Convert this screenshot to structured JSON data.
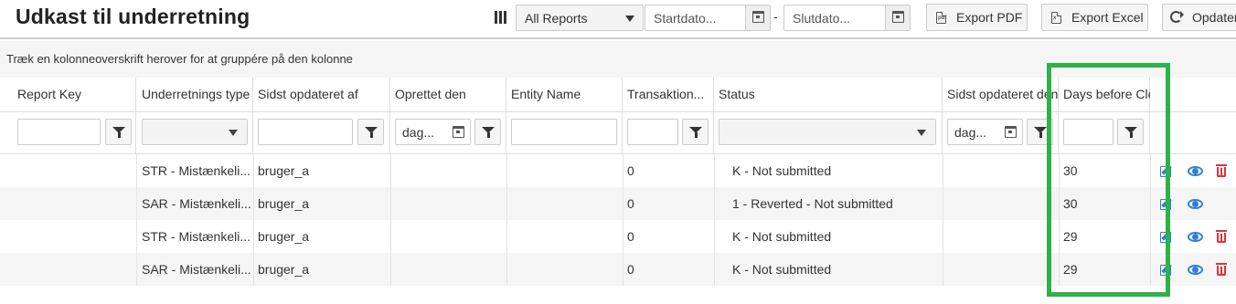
{
  "title": "Udkast til underretning",
  "toolbar": {
    "report_filter": "All Reports",
    "start_date_placeholder": "Startdato...",
    "end_date_placeholder": "Slutdato...",
    "date_separator": "-",
    "export_pdf": "Export PDF",
    "export_excel": "Export Excel",
    "refresh": "Opdater"
  },
  "group_panel": "Træk en kolonneoverskrift herover for at gruppére på den kolonne",
  "columns": [
    "Report Key",
    "Underretnings type",
    "Sidst opdateret af",
    "Oprettet den",
    "Entity Name",
    "Transaktion...",
    "Status",
    "Sidst opdateret den",
    "Days before Cle"
  ],
  "filters": {
    "created_date_placeholder": "dag...",
    "updated_date_placeholder": "dag..."
  },
  "rows": [
    {
      "report_key": "",
      "type": "STR - Mistænkeli...",
      "updated_by": "bruger_a",
      "created": "",
      "entity": "",
      "transactions": "0",
      "status": "K - Not submitted",
      "updated": "",
      "days": "30",
      "can_delete": true
    },
    {
      "report_key": "",
      "type": "SAR - Mistænkeli...",
      "updated_by": "bruger_a",
      "created": "",
      "entity": "",
      "transactions": "0",
      "status": "1 - Reverted - Not submitted",
      "updated": "",
      "days": "30",
      "can_delete": false
    },
    {
      "report_key": "",
      "type": "STR - Mistænkeli...",
      "updated_by": "bruger_a",
      "created": "",
      "entity": "",
      "transactions": "0",
      "status": "K - Not submitted",
      "updated": "",
      "days": "29",
      "can_delete": true
    },
    {
      "report_key": "",
      "type": "SAR - Mistænkeli...",
      "updated_by": "bruger_a",
      "created": "",
      "entity": "",
      "transactions": "0",
      "status": "K - Not submitted",
      "updated": "",
      "days": "29",
      "can_delete": true
    }
  ],
  "icons": {
    "edit": "edit-icon",
    "view": "eye-icon",
    "delete": "trash-icon",
    "filter": "funnel-icon",
    "calendar": "calendar-icon",
    "refresh": "refresh-icon",
    "column_chooser": "columns-icon"
  },
  "colors": {
    "highlight": "#2db24a",
    "action_blue": "#2f80d5",
    "delete_red": "#d9363e"
  }
}
